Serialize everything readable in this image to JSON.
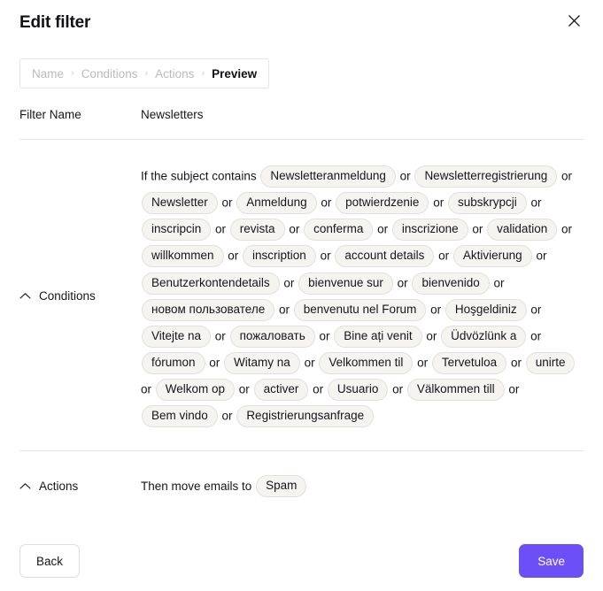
{
  "dialog": {
    "title": "Edit filter",
    "close_icon": "close-icon"
  },
  "breadcrumb": {
    "separator": "›",
    "steps": [
      {
        "label": "Name",
        "active": false
      },
      {
        "label": "Conditions",
        "active": false
      },
      {
        "label": "Actions",
        "active": false
      },
      {
        "label": "Preview",
        "active": true
      }
    ]
  },
  "rows": {
    "filter_name": {
      "label": "Filter Name",
      "value": "Newsletters"
    },
    "conditions": {
      "label": "Conditions",
      "chevron_icon": "chevron-up-icon",
      "lead_text": "If the subject contains",
      "conjunction": "or",
      "tags": [
        "Newsletteranmeldung",
        "Newsletterregistrierung",
        "Newsletter",
        "Anmeldung",
        "potwierdzenie",
        "subskrypcji",
        "inscripcin",
        "revista",
        "conferma",
        "inscrizione",
        "validation",
        "willkommen",
        "inscription",
        "account details",
        "Aktivierung",
        "Benutzerkontendetails",
        "bienvenue sur",
        "bienvenido",
        "новом пользователе",
        "benvenutu nel Forum",
        "Hoşgeldiniz",
        "Vitejte na",
        "пожаловать",
        "Bine ați venit",
        "Üdvözlünk a",
        "fórumon",
        "Witamy na",
        "Velkommen til",
        "Tervetuloa",
        "unirte",
        "Welkom op",
        "activer",
        "Usuario",
        "Välkommen till",
        "Bem vindo",
        "Registrierungsanfrage"
      ]
    },
    "actions": {
      "label": "Actions",
      "chevron_icon": "chevron-up-icon",
      "lead_text": "Then move emails to",
      "tags": [
        "Spam"
      ]
    }
  },
  "footer": {
    "back_label": "Back",
    "save_label": "Save",
    "save_color": "#6c4ff6"
  }
}
